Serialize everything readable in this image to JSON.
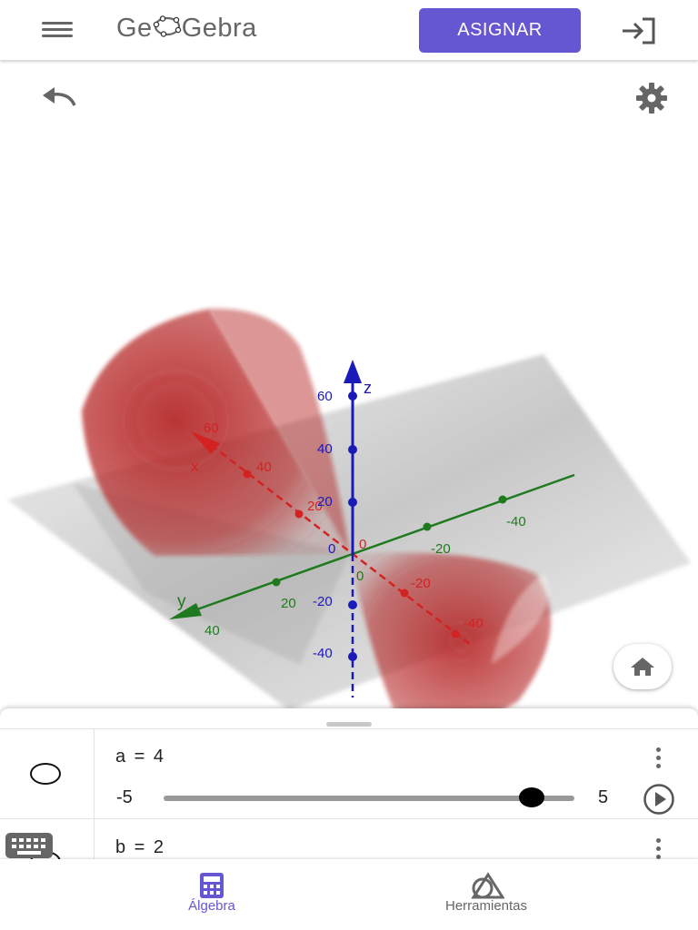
{
  "header": {
    "logo_text_pre": "Ge",
    "logo_text_post": "Gebra",
    "assign_label": "ASIGNAR"
  },
  "colors": {
    "accent": "#6557d2",
    "x_axis": "#d32222",
    "y_axis": "#1f7a1f",
    "z_axis": "#1a1ab8",
    "surface": "#b21d1d",
    "plane": "#bfbfbf"
  },
  "graphics": {
    "axes": {
      "x": {
        "label": "x",
        "ticks": [
          "60",
          "40",
          "20",
          "0",
          "-20",
          "-40"
        ]
      },
      "y": {
        "label": "y",
        "ticks": [
          "40",
          "20",
          "0",
          "-20",
          "-40"
        ]
      },
      "z": {
        "label": "z",
        "ticks": [
          "60",
          "40",
          "20",
          "0",
          "-20",
          "-40"
        ]
      }
    }
  },
  "algebra": {
    "items": [
      {
        "expression": "a = 4",
        "slider_min": "-5",
        "slider_max": "5",
        "value": 4,
        "min": -5,
        "max": 5
      },
      {
        "expression": "b = 2"
      }
    ]
  },
  "bottom_nav": {
    "tabs": [
      {
        "label": "Álgebra",
        "active": true
      },
      {
        "label": "Herramientas",
        "active": false
      }
    ]
  }
}
